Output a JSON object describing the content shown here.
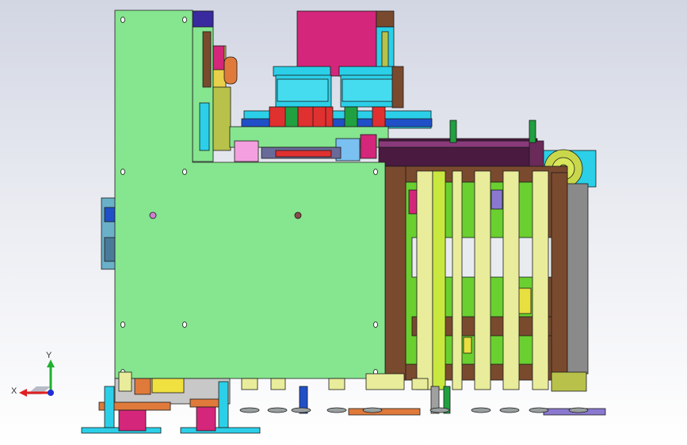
{
  "viewport": {
    "name": "cad-viewport",
    "background_top": "#d2d6e3",
    "background_bottom": "#ffffff"
  },
  "model": {
    "main_plate_color": "#86e58f",
    "post_color": "#e9ec9a",
    "brown_color": "#7a4a2e",
    "magenta_color": "#d4267a",
    "cyan_color": "#2bd0e8",
    "dark_purple_color": "#4a1a40",
    "olive_color": "#b8c24a",
    "orange_color": "#e07a3a",
    "purple_color": "#8a78d0",
    "blue_color": "#2050c8",
    "edge_color": "#1a1a1a"
  },
  "triad": {
    "x_label": "X",
    "y_label": "Y",
    "x_color": "#e02020",
    "y_color": "#20b030",
    "z_color": "#2030d0"
  }
}
